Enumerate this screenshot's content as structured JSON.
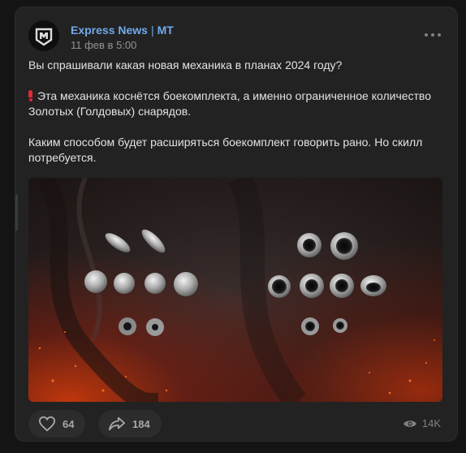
{
  "post": {
    "author": "Express News",
    "author_tag": "MT",
    "date": "11 фев в 5:00",
    "paragraph_1": "Вы спрашивали какая новая механика в планах 2024 году?",
    "paragraph_2": "Эта механика коснётся боекомплекта, а именно ограниченное количество Золотых (Голдовых) снарядов.",
    "paragraph_3": "Каким способом будет расширяться боекомплект говорить рано. Но скилл потребуется."
  },
  "footer": {
    "likes": "64",
    "shares": "184",
    "views": "14K"
  },
  "icons": {
    "avatar": "mt-logo-icon",
    "more": "more-dots-icon",
    "alert": "exclamation-icon",
    "like": "heart-icon",
    "share": "share-arrow-icon",
    "views": "eye-icon"
  },
  "colors": {
    "link": "#71aaeb",
    "alert": "#e3283a",
    "card": "#222222"
  }
}
